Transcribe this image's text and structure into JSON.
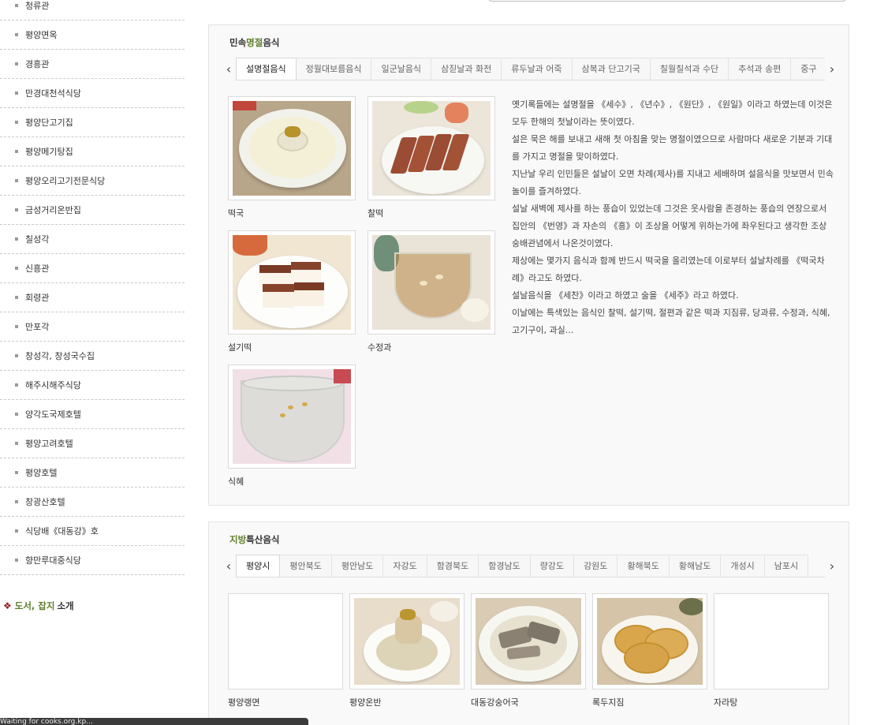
{
  "sidebar": {
    "items": [
      {
        "label": "청류관"
      },
      {
        "label": "평양면옥"
      },
      {
        "label": "경흥관"
      },
      {
        "label": "만경대천석식당"
      },
      {
        "label": "평양단고기집"
      },
      {
        "label": "평양메기탕집"
      },
      {
        "label": "평양오리고기전문식당"
      },
      {
        "label": "금성거리온반집"
      },
      {
        "label": "칠성각"
      },
      {
        "label": "신흥관"
      },
      {
        "label": "회령관"
      },
      {
        "label": "만포각"
      },
      {
        "label": "창성각, 창성국수집"
      },
      {
        "label": "해주시해주식당"
      },
      {
        "label": "양각도국제호텔"
      },
      {
        "label": "평양고려호텔"
      },
      {
        "label": "평양호텔"
      },
      {
        "label": "창광산호텔"
      },
      {
        "label": "식당배《대동강》호"
      },
      {
        "label": "향만루대중식당"
      }
    ],
    "books": {
      "icon": "flower-icon",
      "green": "도서, 잡지",
      "rest": "소개"
    }
  },
  "holiday": {
    "title_a": "민속",
    "title_b": "명절",
    "title_c": "음식",
    "tabs": [
      "설명절음식",
      "정월대보름음식",
      "일군날음식",
      "삼짇날과 화전",
      "류두날과 어죽",
      "삼복과 단고기국",
      "칠월칠석과 수단",
      "추석과 송편",
      "중구"
    ],
    "foods": [
      {
        "name": "떡국"
      },
      {
        "name": "찰떡"
      },
      {
        "name": "설기떡"
      },
      {
        "name": "수정과"
      },
      {
        "name": "식혜"
      }
    ],
    "paragraphs": [
      "옛기록들에는 설명절을 《세수》, 《년수》, 《원단》, 《원일》이라고 하였는데 이것은 모두 한해의 첫날이라는 뜻이였다.",
      "설은 묵은 해를 보내고 새해 첫 아침을 맞는 명절이였으므로 사람마다 새로운 기분과 기대를 가지고 명절을 맞이하였다.",
      "지난날 우리 인민들은 설날이 오면 차례(제사)를 지내고 세배하며 설음식을 맛보면서 민속놀이를 즐겨하였다.",
      "설날 새벽에 제사를 하는 풍습이 있었는데 그것은 웃사람을 존경하는 풍습의 연장으로서 집안의 《번영》과 자손의 《흥》이 조상을 어떻게 위하는가에 좌우된다고 생각한 조상숭배관념에서 나온것이였다.",
      "제상에는 몇가지 음식과 함께 반드시 떡국을 올리였는데 이로부터 설날차례를 《떡국차례》라고도 하였다.",
      "설날음식을 《세찬》이라고 하였고 술을 《세주》라고 하였다.",
      "이날에는 특색있는 음식인 찰떡, 설기떡, 절편과 같은 떡과 지짐류, 당과류, 수정과, 식혜, 고기구이, 과실..."
    ]
  },
  "regional": {
    "title_a": "지방",
    "title_b": "특산음식",
    "tabs": [
      "평양시",
      "평안북도",
      "평안남도",
      "자강도",
      "함경북도",
      "함경남도",
      "량강도",
      "강원도",
      "황해북도",
      "황해남도",
      "개성시",
      "남포시"
    ],
    "foods": [
      {
        "name": "평양랭면"
      },
      {
        "name": "평양온반"
      },
      {
        "name": "대동강숭어국"
      },
      {
        "name": "록두지짐"
      },
      {
        "name": "자라탕"
      }
    ]
  },
  "arrows": {
    "left": "‹",
    "right": "›"
  },
  "status": {
    "text": "Waiting for cooks.org.kp..."
  }
}
